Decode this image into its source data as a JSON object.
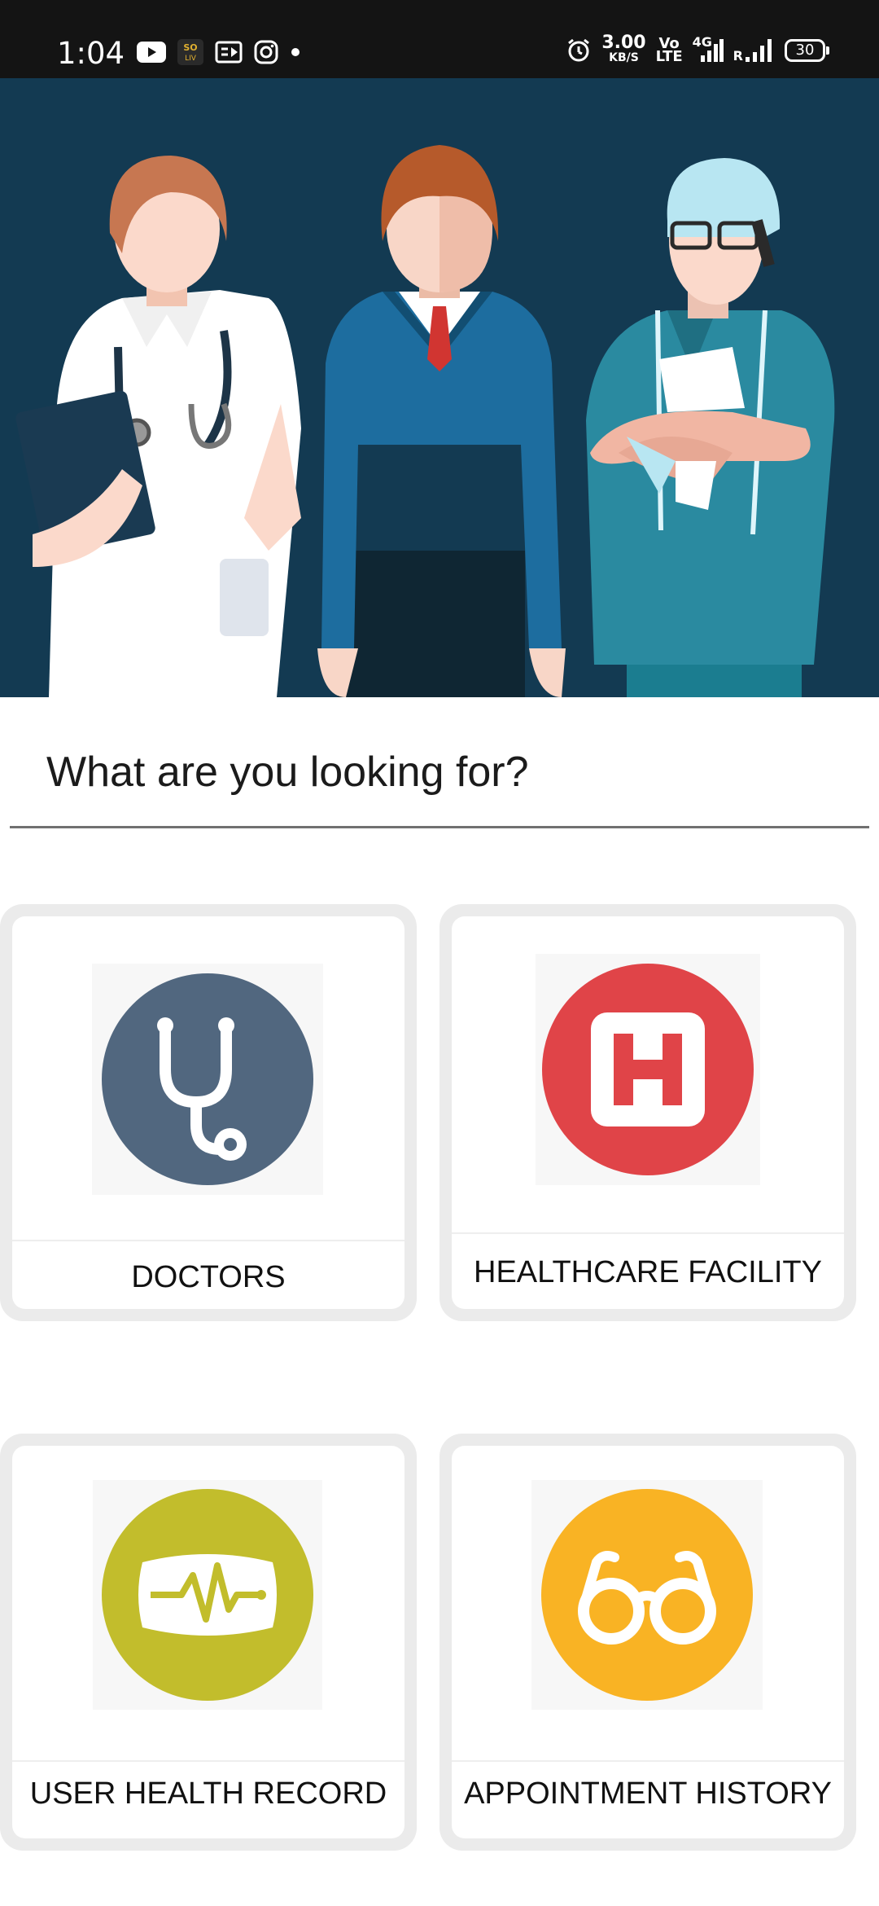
{
  "status_bar": {
    "time": "1:04",
    "speed_value": "3.00",
    "speed_unit": "KB/S",
    "volte": "Vo",
    "volte_sub": "LTE",
    "network": "4G",
    "roaming": "R",
    "battery": "30",
    "left_icons": [
      "youtube-icon",
      "sonyliv-icon",
      "news-icon",
      "instagram-icon",
      "dot-icon"
    ],
    "right_icons": [
      "alarm-icon",
      "signal-icon",
      "signal-icon"
    ]
  },
  "hero": {
    "icon": "medical-staff-illustration",
    "colors": {
      "background": "#133a52"
    }
  },
  "main": {
    "question": "What are you looking for?"
  },
  "cards": [
    {
      "label": "DOCTORS",
      "icon": "stethoscope-icon",
      "color": "#51677f"
    },
    {
      "label": "HEALTHCARE FACILITY",
      "icon": "hospital-icon",
      "color": "#e04448"
    },
    {
      "label": "USER HEALTH RECORD",
      "icon": "heartbeat-monitor-icon",
      "color": "#c2bd2c"
    },
    {
      "label": "APPOINTMENT HISTORY",
      "icon": "glasses-icon",
      "color": "#f9b324"
    }
  ]
}
